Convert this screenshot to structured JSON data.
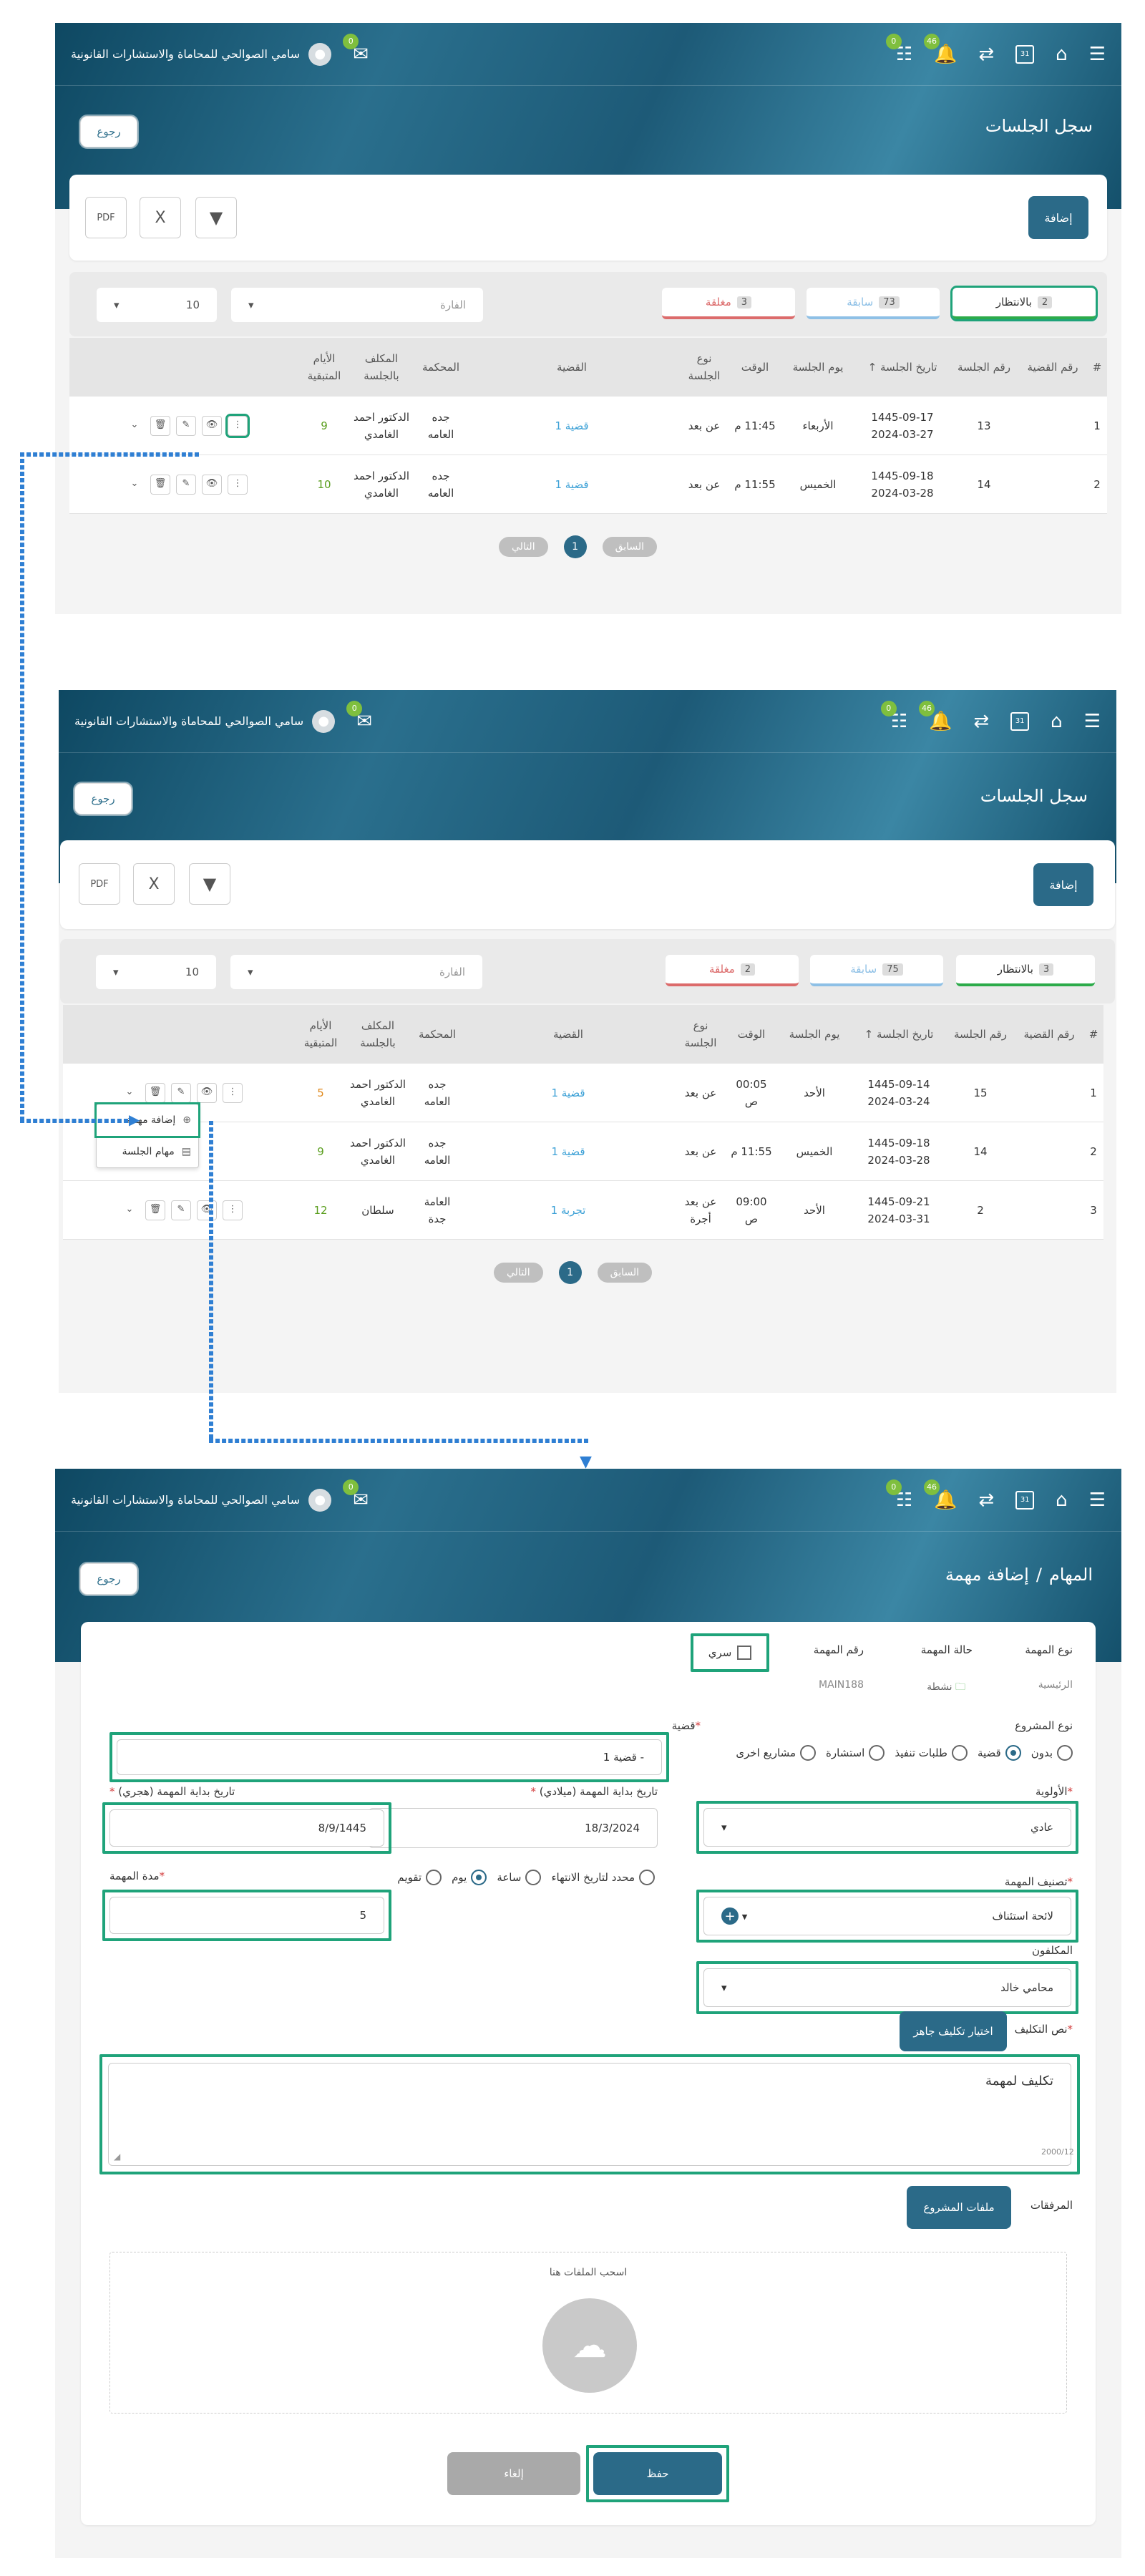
{
  "common": {
    "company": "سامي الصوالحي للمحاماة والاستشارات القانونية",
    "back": "رجوع",
    "menu_icon": "hamburger-icon",
    "badges": {
      "chat": "0",
      "bell": "46",
      "msg": "0"
    },
    "calendar_day": "31"
  },
  "screen1": {
    "title": "سجل الجلسات",
    "add": "إضافة",
    "tabs": [
      {
        "label": "بالانتظار",
        "count": "2"
      },
      {
        "label": "سابقة",
        "count": "73"
      },
      {
        "label": "مغلقة",
        "count": "3"
      }
    ],
    "filter_placeholder": "الفارة",
    "page_size": "10",
    "headers": [
      "#",
      "رقم القضية",
      "رقم الجلسة",
      "تاريخ الجلسة",
      "يوم الجلسة",
      "الوقت",
      "نوع الجلسة",
      "القضية",
      "المحكمة",
      "المكلف بالجلسة",
      "الأيام المتبقية"
    ],
    "rows": [
      {
        "num": "1",
        "case_no": "",
        "session_no": "13",
        "date_h": "1445-09-17",
        "date_g": "2024-03-27",
        "day": "الأربعاء",
        "time": "11:45 م",
        "type": "عن بعد",
        "case": "قضية 1",
        "court1": "جده",
        "court2": "العامه",
        "assignee1": "الدكتور احمد",
        "assignee2": "الغامدي",
        "days": "9"
      },
      {
        "num": "2",
        "case_no": "",
        "session_no": "14",
        "date_h": "1445-09-18",
        "date_g": "2024-03-28",
        "day": "الخميس",
        "time": "11:55 م",
        "type": "عن بعد",
        "case": "قضية 1",
        "court1": "جده",
        "court2": "العامه",
        "assignee1": "الدكتور احمد",
        "assignee2": "الغامدي",
        "days": "10"
      }
    ],
    "pager": {
      "prev": "السابق",
      "current": "1",
      "next": "التالي"
    }
  },
  "screen2": {
    "title": "سجل الجلسات",
    "add": "إضافة",
    "tabs": [
      {
        "label": "بالانتظار",
        "count": "3"
      },
      {
        "label": "سابقة",
        "count": "75"
      },
      {
        "label": "مغلقة",
        "count": "2"
      }
    ],
    "filter_placeholder": "الفارة",
    "page_size": "10",
    "rows": [
      {
        "num": "1",
        "case_no": "",
        "session_no": "15",
        "date_h": "1445-09-14",
        "date_g": "2024-03-24",
        "day": "الأحد",
        "time": "00:05 ص",
        "type": "عن بعد",
        "type2": "",
        "case": "قضية 1",
        "court1": "جده",
        "court2": "العامه",
        "assignee1": "الدكتور احمد",
        "assignee2": "الغامدي",
        "days": "5"
      },
      {
        "num": "2",
        "case_no": "",
        "session_no": "14",
        "date_h": "1445-09-18",
        "date_g": "2024-03-28",
        "day": "الخميس",
        "time": "11:55 م",
        "type": "عن بعد",
        "type2": "",
        "case": "قضية 1",
        "court1": "جده",
        "court2": "العامه",
        "assignee1": "الدكتور احمد",
        "assignee2": "الغامدي",
        "days": "9"
      },
      {
        "num": "3",
        "case_no": "",
        "session_no": "2",
        "date_h": "1445-09-21",
        "date_g": "2024-03-31",
        "day": "الأحد",
        "time": "09:00 ص",
        "type": "عن بعد",
        "type2": "أجرة",
        "case": "تجربة 1",
        "court1": "العامة",
        "court2": "جدة",
        "assignee1": "سلطان",
        "assignee2": "",
        "days": "12"
      }
    ],
    "dropdown": {
      "add_task": "إضافة مهمة",
      "session_tasks": "مهام الجلسة"
    },
    "pager": {
      "prev": "السابق",
      "current": "1",
      "next": "التالي"
    }
  },
  "screen3": {
    "breadcrumb_root": "المهام",
    "breadcrumb_sep": "/",
    "title": "إضافة مهمة",
    "task_type_label": "نوع المهمة",
    "task_type_value": "الرئيسية",
    "task_status_label": "حالة المهمة",
    "task_status_value": "نشطة",
    "task_no_label": "رقم المهمة",
    "task_no_value": "MAIN188",
    "secret_label": "سري",
    "project_type_label": "نوع المشروع",
    "project_types": [
      "بدون",
      "قضية",
      "طلبات تنفيذ",
      "استشارة",
      "مشاريع اخرى"
    ],
    "case_label": "قضية",
    "case_value": "- قضية 1",
    "priority_label": "الأولوية",
    "priority_value": "عادي",
    "start_g_label": "تاريخ بداية المهمة (ميلادي)",
    "start_g_value": "18/3/2024",
    "start_h_label": "تاريخ بداية المهمة (هجري)",
    "start_h_value": "8/9/1445",
    "category_label": "تصنيف المهمة",
    "category_value": "لائحة استئناف",
    "duration_type_label": "محدد لتاريخ الانتهاء",
    "duration_types": [
      "ساعة",
      "يوم",
      "تقويم"
    ],
    "duration_label": "مدة المهمة",
    "duration_value": "5",
    "assignees_label": "المكلفون",
    "assignees_value": "محامي خالد",
    "assignment_text_label": "نص التكليف",
    "ready_btn": "اختيار تكليف جاهز",
    "assignment_text": "تكليف لمهمة",
    "char_count": "2000/12",
    "attachments_label": "المرفقات",
    "project_files_btn": "ملفات المشروع",
    "drop_text": "اسحب الملفات هنا",
    "save": "حفظ",
    "cancel": "إلغاء"
  },
  "colors": {
    "teal": "#2b6a88",
    "green": "#1fa37a",
    "link": "#3ba0d6",
    "danger": "#d23b3b"
  }
}
